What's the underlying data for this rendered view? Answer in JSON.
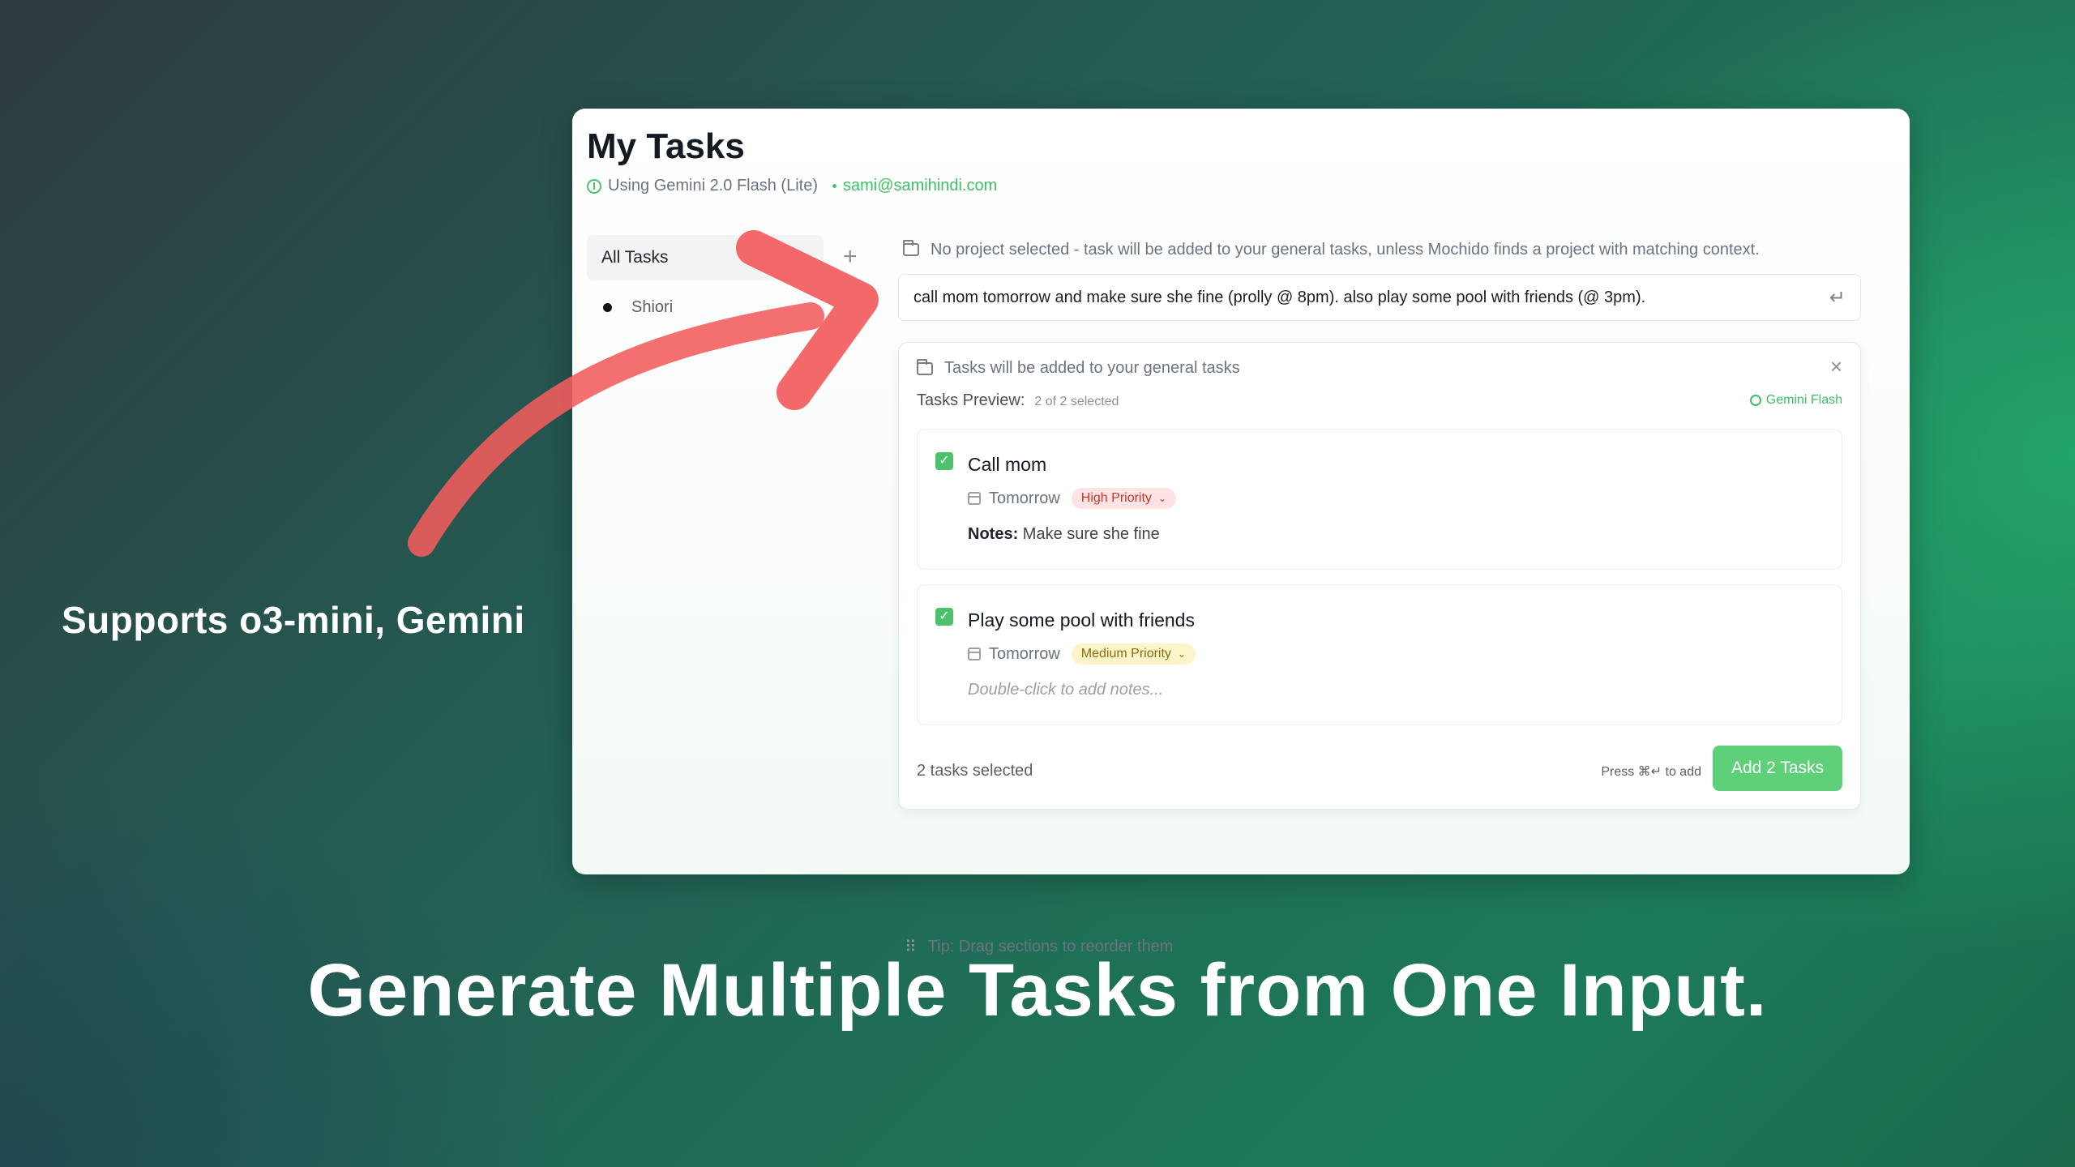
{
  "caption_left": "Supports o3-mini, Gemini",
  "headline": "Generate Multiple Tasks from One Input.",
  "app": {
    "title": "My Tasks",
    "model_label": "Using Gemini 2.0 Flash (Lite)",
    "user_email": "sami@samihindi.com"
  },
  "sidebar": {
    "all_tasks_label": "All Tasks",
    "add_icon": "+",
    "projects": [
      {
        "label": "Shiori"
      }
    ]
  },
  "main": {
    "project_note": "No project selected - task will be added to your general tasks, unless Mochido finds a project with matching context.",
    "input_value": "call mom tomorrow and make sure she fine (prolly @ 8pm). also play some pool with friends (@ 3pm).",
    "return_icon": "↵",
    "preview": {
      "destination_note": "Tasks will be added to your general tasks",
      "close_icon": "×",
      "title": "Tasks Preview:",
      "selected_count": "2 of 2 selected",
      "model_tag": "Gemini Flash",
      "tasks": [
        {
          "title": "Call mom",
          "due": "Tomorrow",
          "priority": "High Priority",
          "notes_label": "Notes:",
          "notes": "Make sure she fine",
          "checked": true
        },
        {
          "title": "Play some pool with friends",
          "due": "Tomorrow",
          "priority": "Medium Priority",
          "notes_placeholder": "Double-click to add notes...",
          "checked": true
        }
      ],
      "footer_selected": "2 tasks selected",
      "shortcut_hint": "Press ⌘↵ to add",
      "add_button_label": "Add 2 Tasks"
    },
    "tip": "Tip: Drag sections to reorder them"
  },
  "colors": {
    "accent_green": "#4cc36a",
    "button_green": "#5fd07a",
    "arrow_red": "#f25c5c",
    "high_priority_bg": "#fde3e3",
    "medium_priority_bg": "#fdf4c9"
  }
}
